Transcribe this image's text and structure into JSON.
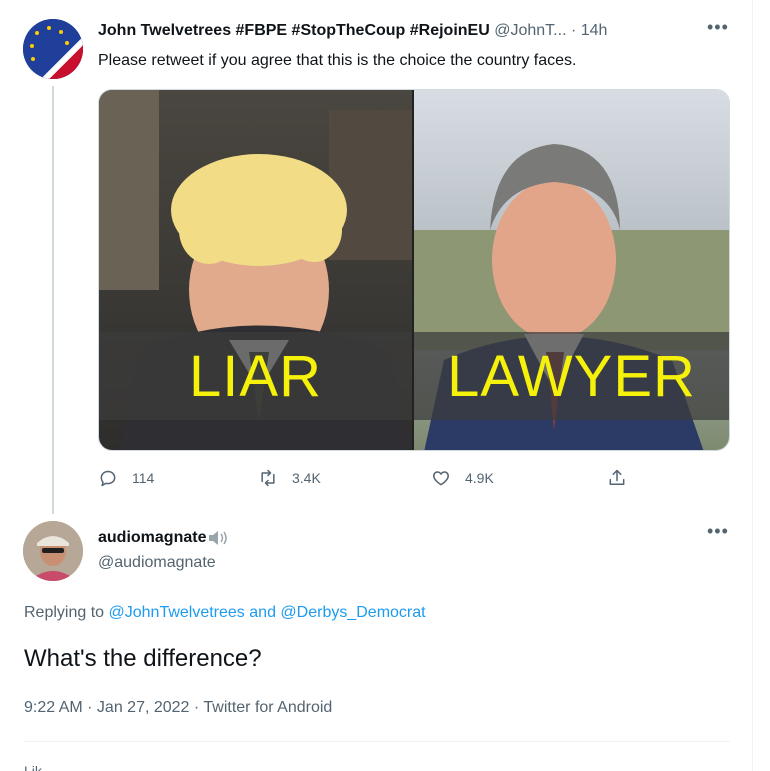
{
  "tweet1": {
    "display_name": "John Twelvetrees #FBPE #StopTheCoup #RejoinEU",
    "handle": "@JohnT...",
    "separator": "·",
    "time": "14h",
    "text": "Please retweet if you agree that this is the choice the country faces.",
    "media": {
      "left_caption": "LIAR",
      "right_caption": "LAWYER"
    },
    "actions": {
      "replies": "114",
      "retweets": "3.4K",
      "likes": "4.9K"
    }
  },
  "tweet2": {
    "display_name": "audiomagnate",
    "handle": "@audiomagnate",
    "replying_prefix": "Replying to",
    "replying_user1": "@JohnTwelvetrees",
    "replying_and": "and",
    "replying_user2": "@Derbys_Democrat",
    "text": "What's the difference?",
    "timestamp": "9:22 AM · Jan 27, 2022 · Twitter for Android",
    "truncated_next": "Lik"
  },
  "colors": {
    "accent": "#1d9bf0",
    "muted": "#536471",
    "caption": "#f5f10a"
  },
  "icons": {
    "reply": "speech-bubble-icon",
    "retweet": "retweet-arrows-icon",
    "like": "heart-outline-icon",
    "share": "share-upload-icon",
    "more": "ellipsis-icon",
    "speaker": "speaker-icon"
  }
}
